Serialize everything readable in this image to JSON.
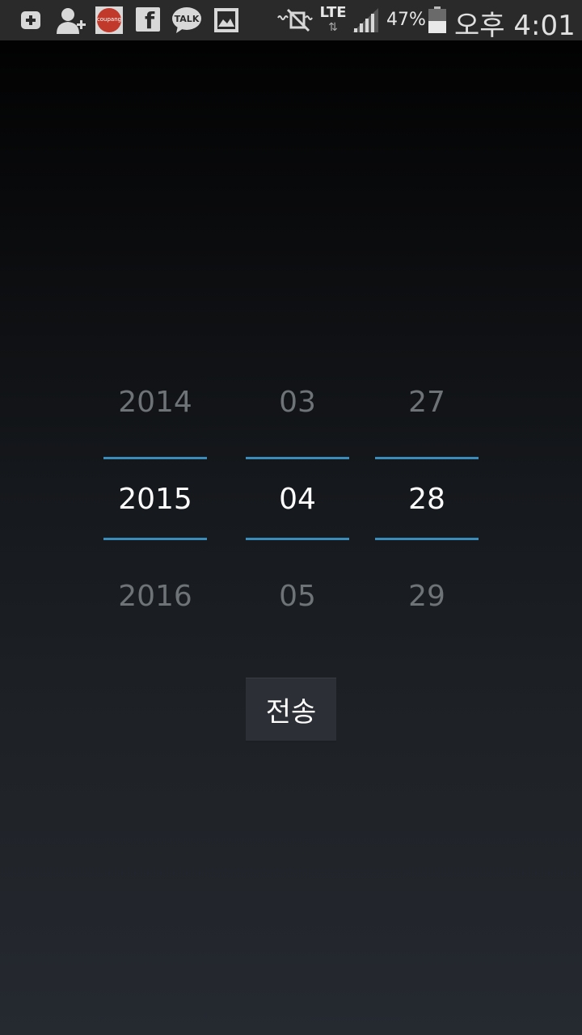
{
  "status_bar": {
    "battery_percent": "47%",
    "network_type": "LTE",
    "time": "오후 4:01",
    "app_icon_talk_label": "TALK",
    "app_icon_coupang_label": "coupang",
    "icons": [
      "add-icon",
      "add-contact-icon",
      "coupang-icon",
      "facebook-icon",
      "kakaotalk-icon",
      "gallery-icon",
      "mute-icon",
      "lte-icon",
      "signal-icon",
      "battery-icon"
    ]
  },
  "date_picker": {
    "year": {
      "prev": "2014",
      "current": "2015",
      "next": "2016"
    },
    "month": {
      "prev": "03",
      "current": "04",
      "next": "05"
    },
    "day": {
      "prev": "27",
      "current": "28",
      "next": "29"
    },
    "accent_color": "#3a8dba"
  },
  "send_button": {
    "label": "전송"
  }
}
